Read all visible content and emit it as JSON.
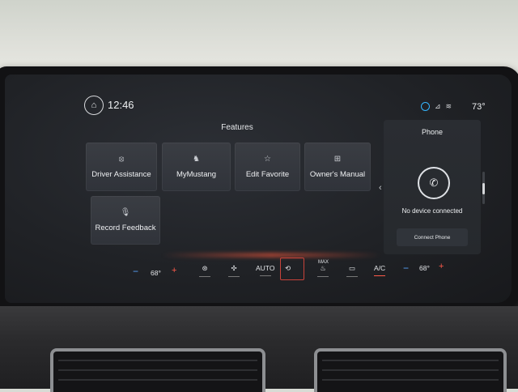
{
  "status_bar": {
    "time": "12:46",
    "outside_temp": "73°",
    "icons": [
      "home-icon",
      "alexa-icon",
      "signal-icon",
      "wifi-icon"
    ]
  },
  "features": {
    "title": "Features",
    "tiles": [
      {
        "label": "Driver Assistance",
        "icon": "driver-assist-icon"
      },
      {
        "label": "MyMustang",
        "icon": "mustang-pony-icon"
      },
      {
        "label": "Edit Favorite",
        "icon": "star-icon"
      },
      {
        "label": "Owner's Manual",
        "icon": "book-icon"
      },
      {
        "label": "Record Feedback",
        "icon": "microphone-icon"
      }
    ]
  },
  "phone": {
    "title": "Phone",
    "status": "No device connected",
    "connect_label": "Connect Phone"
  },
  "climate": {
    "left_temp": "68°",
    "right_temp": "68°",
    "auto_label": "AUTO",
    "max_label": "MAX",
    "ac_label": "A/C",
    "minus": "−",
    "plus": "+"
  },
  "colors": {
    "accent_blue": "#35b6ff",
    "temp_down": "#5aa6ff",
    "temp_up": "#ff5a4a",
    "active_outline": "#c8433a"
  }
}
